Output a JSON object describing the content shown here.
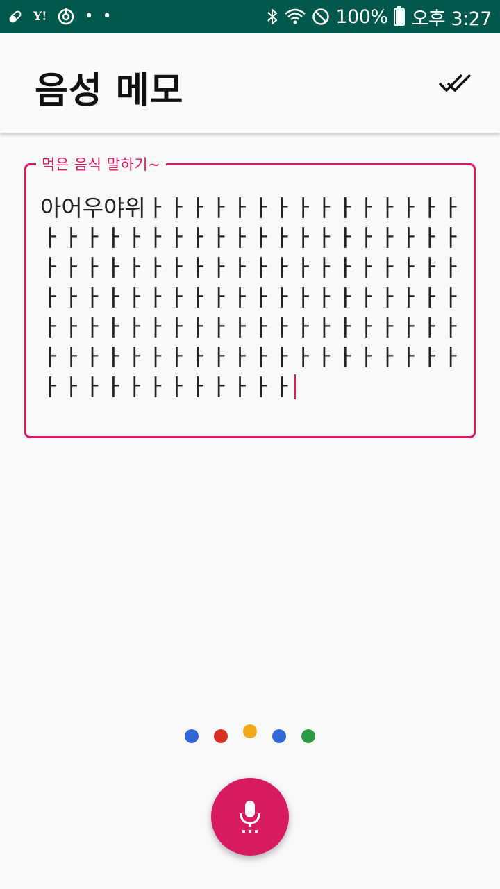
{
  "status_bar": {
    "yahoo_label": "Y!",
    "notification_dots": "• •",
    "battery_percent": "100%",
    "clock": "오후 3:27",
    "icons": [
      "pill-icon",
      "yahoo-icon",
      "sync-icon",
      "more-notifications-icon",
      "bluetooth-icon",
      "wifi-icon",
      "do-not-disturb-icon",
      "battery-icon"
    ]
  },
  "app_bar": {
    "title": "음성 메모",
    "action_icon": "done-all-icon"
  },
  "memo_field": {
    "label": "먹은 음식 말하기~",
    "value": "아어우야위ㅏㅏㅏㅏㅏㅏㅏㅏㅏㅏㅏㅏㅏㅏㅏㅏㅏㅏㅏㅏㅏㅏㅏㅏㅏㅏㅏㅏㅏㅏㅏㅏㅏㅏㅏㅏㅏㅏㅏㅏㅏㅏㅏㅏㅏㅏㅏㅏㅏㅏㅏㅏㅏㅏㅏㅏㅏㅏㅏㅏㅏㅏㅏㅏㅏㅏㅏㅏㅏㅏㅏㅏㅏㅏㅏㅏㅏㅏㅏㅏㅏㅏㅏㅏㅏㅏㅏㅏㅏㅏㅏㅏㅏㅏㅏㅏㅏㅏㅏㅏㅏㅏㅏㅏㅏㅏㅏㅏㅏㅏㅏㅏㅏㅏㅏㅏㅏㅏㅏㅏㅏㅏㅏㅏㅏㅏㅏ",
    "accent_color": "#d81b60"
  },
  "listening_indicator": {
    "dot_colors": [
      "#3367d6",
      "#d93025",
      "#f0a81a",
      "#3367d6",
      "#2e9a44"
    ]
  },
  "mic_button": {
    "icon": "mic-icon",
    "color": "#d81b60"
  }
}
